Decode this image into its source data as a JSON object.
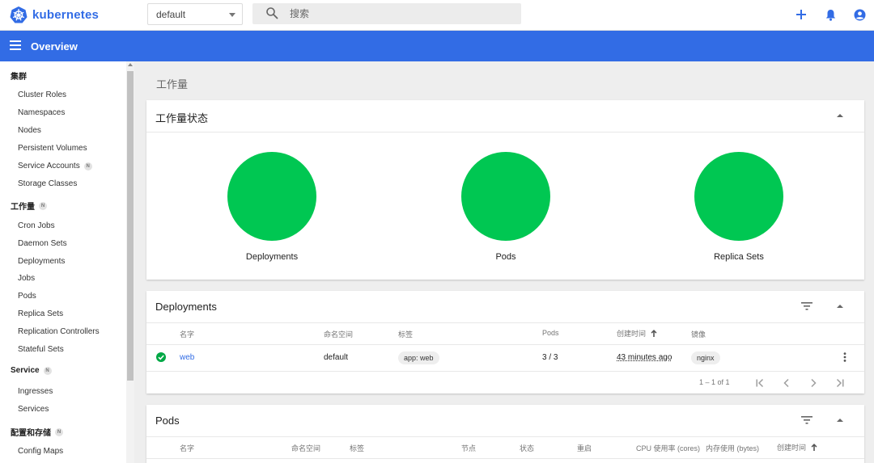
{
  "app": {
    "title": "kubernetes",
    "namespace": "default",
    "search_placeholder": "搜索"
  },
  "header": {
    "title": "Overview"
  },
  "sidebar": {
    "groups": [
      {
        "label": "集群",
        "badge": "",
        "items": [
          "Cluster Roles",
          "Namespaces",
          "Nodes",
          "Persistent Volumes",
          "Service Accounts",
          "Storage Classes"
        ],
        "item_badges": [
          "",
          "",
          "",
          "",
          "N",
          ""
        ]
      },
      {
        "label": "工作量",
        "badge": "N",
        "items": [
          "Cron Jobs",
          "Daemon Sets",
          "Deployments",
          "Jobs",
          "Pods",
          "Replica Sets",
          "Replication Controllers",
          "Stateful Sets"
        ]
      },
      {
        "label": "Service",
        "badge": "N",
        "items": [
          "Ingresses",
          "Services"
        ]
      },
      {
        "label": "配置和存储",
        "badge": "N",
        "items": [
          "Config Maps"
        ]
      }
    ]
  },
  "main": {
    "title": "工作量",
    "status_card": {
      "title": "工作量状态",
      "items": [
        {
          "label": "Deployments",
          "color": "#00c752"
        },
        {
          "label": "Pods",
          "color": "#00c752"
        },
        {
          "label": "Replica Sets",
          "color": "#00c752"
        }
      ]
    },
    "deployments": {
      "title": "Deployments",
      "columns": [
        "名字",
        "命名空间",
        "标签",
        "Pods",
        "创建时间",
        "镜像"
      ],
      "rows": [
        {
          "name": "web",
          "namespace": "default",
          "labels": "app: web",
          "pods": "3 / 3",
          "created": "43 minutes ago",
          "image": "nginx",
          "status": "ok"
        }
      ],
      "pagination": "1 – 1 of 1"
    },
    "pods": {
      "title": "Pods",
      "columns": [
        "名字",
        "命名空间",
        "标签",
        "节点",
        "状态",
        "重启",
        "CPU 使用率 (cores)",
        "内存使用 (bytes)",
        "创建时间"
      ]
    }
  },
  "colors": {
    "brand": "#326ce5",
    "status_ok": "#00c752"
  }
}
